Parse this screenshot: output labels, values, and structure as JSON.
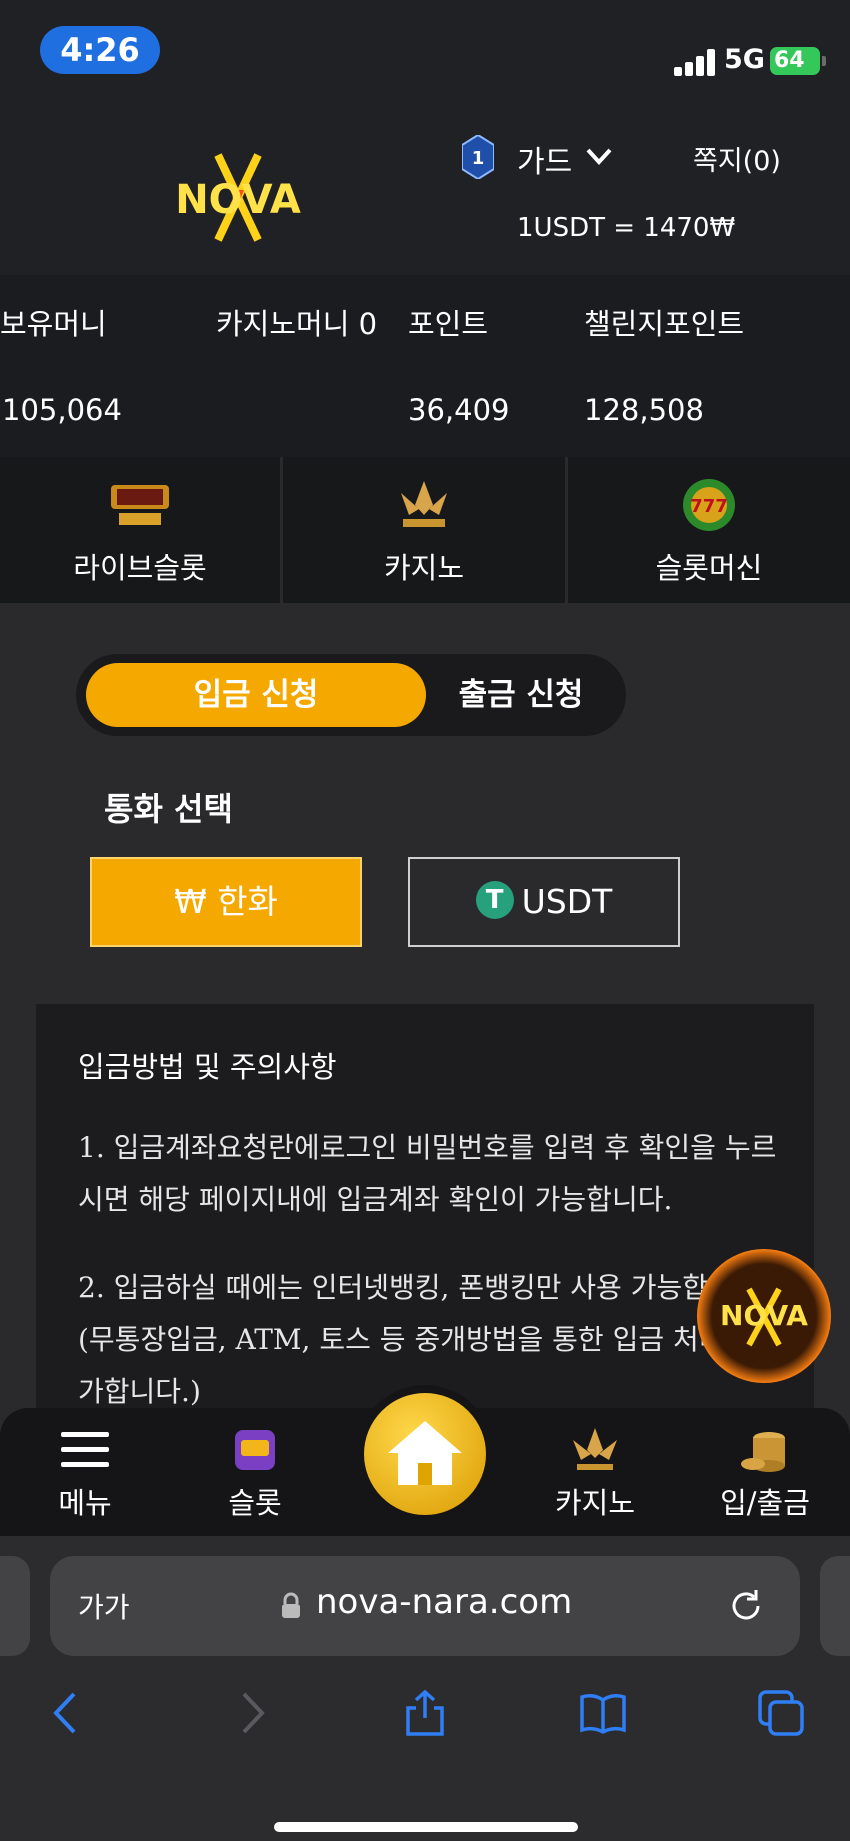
{
  "status": {
    "time": "4:26",
    "network": "5G",
    "battery": "64"
  },
  "header": {
    "logo_text": "NOVA",
    "level": "1",
    "rank": "가드",
    "messages": "쪽지(0)",
    "rate": "1USDT = 1470₩"
  },
  "balances": {
    "held_money_label": "보유머니",
    "casino_money_label": "카지노머니 0",
    "point_label": "포인트",
    "challenge_point_label": "챌린지포인트",
    "held_money_value": "105,064",
    "point_value": "36,409",
    "challenge_point_value": "128,508"
  },
  "categories": [
    {
      "label": "라이브슬롯",
      "icon": "live-slot-icon"
    },
    {
      "label": "카지노",
      "icon": "k-slot-icon"
    },
    {
      "label": "슬롯머신",
      "icon": "777-slots-icon"
    }
  ],
  "tabs": {
    "deposit": "입금 신청",
    "withdraw": "출금 신청",
    "active": "deposit"
  },
  "currency": {
    "title": "통화 선택",
    "krw": "₩ 한화",
    "usdt": "USDT",
    "selected": "krw"
  },
  "notice": {
    "title": "입금방법 및 주의사항",
    "item1": "1. 입금계좌요청란에로그인 비밀번호를 입력 후 확인을 누르시면 해당 페이지내에 입금계좌 확인이 가능합니다.",
    "item2": "2. 입금하실 때에는 인터넷뱅킹, 폰뱅킹만 사용 가능합니다.(무통장입금, ATM, 토스 등 중개방법을 통한 입금 처리 불가합니다.)"
  },
  "bottom_nav": {
    "menu": "메뉴",
    "slot": "슬롯",
    "casino": "카지노",
    "deposit_withdraw": "입/출금"
  },
  "browser": {
    "text_size": "가가",
    "url": "nova-nara.com"
  },
  "colors": {
    "accent": "#f5a800",
    "background": "#2a2a2d",
    "usdt": "#26a17b",
    "ios_blue": "#2f7ef5"
  }
}
